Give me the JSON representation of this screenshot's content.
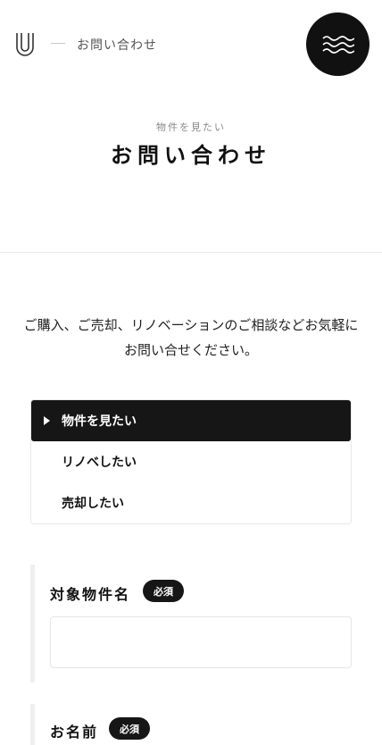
{
  "header": {
    "breadcrumb": "お問い合わせ",
    "logo_icon": "u-logo-icon",
    "menu_icon": "wave-menu-icon"
  },
  "hero": {
    "subtitle": "物件を見たい",
    "title": "お問い合わせ"
  },
  "intro": {
    "text": "ご購入、ご売却、リノベーションのご相談などお気軽にお問い合せください。"
  },
  "tabs": [
    {
      "label": "物件を見たい",
      "active": true
    },
    {
      "label": "リノベしたい",
      "active": false
    },
    {
      "label": "売却したい",
      "active": false
    }
  ],
  "form": {
    "required_label": "必須",
    "fields": [
      {
        "label": "対象物件名",
        "value": ""
      },
      {
        "label": "お名前",
        "value": ""
      }
    ]
  },
  "colors": {
    "accent": "#161616",
    "bar": "#efefef"
  }
}
